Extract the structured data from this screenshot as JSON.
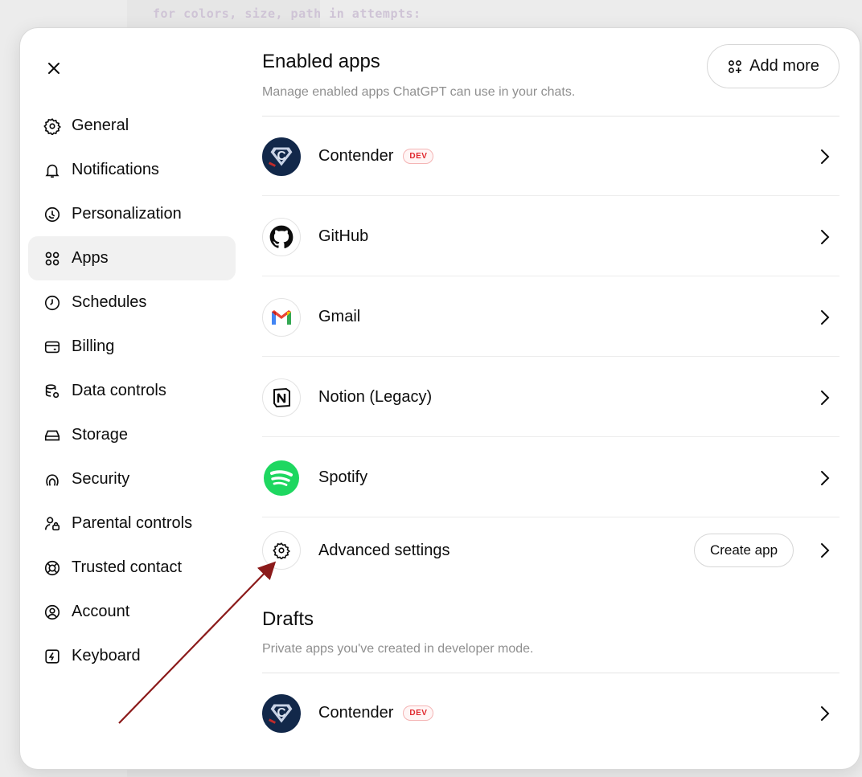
{
  "backdrop": {
    "code_line": "for colors, size, path in attempts:"
  },
  "sidebar": {
    "items": [
      {
        "label": "General",
        "icon": "gear-icon",
        "active": false
      },
      {
        "label": "Notifications",
        "icon": "bell-icon",
        "active": false
      },
      {
        "label": "Personalization",
        "icon": "personalization-icon",
        "active": false
      },
      {
        "label": "Apps",
        "icon": "apps-grid-icon",
        "active": true
      },
      {
        "label": "Schedules",
        "icon": "clock-icon",
        "active": false
      },
      {
        "label": "Billing",
        "icon": "card-icon",
        "active": false
      },
      {
        "label": "Data controls",
        "icon": "database-icon",
        "active": false
      },
      {
        "label": "Storage",
        "icon": "storage-icon",
        "active": false
      },
      {
        "label": "Security",
        "icon": "fingerprint-icon",
        "active": false
      },
      {
        "label": "Parental controls",
        "icon": "parental-icon",
        "active": false
      },
      {
        "label": "Trusted contact",
        "icon": "lifebuoy-icon",
        "active": false
      },
      {
        "label": "Account",
        "icon": "account-icon",
        "active": false
      },
      {
        "label": "Keyboard",
        "icon": "keyboard-icon",
        "active": false
      }
    ]
  },
  "enabled": {
    "title": "Enabled apps",
    "subtitle": "Manage enabled apps ChatGPT can use in your chats.",
    "add_more_label": "Add more",
    "apps": [
      {
        "name": "Contender",
        "badge": "DEV",
        "icon": "contender-logo-icon"
      },
      {
        "name": "GitHub",
        "badge": "",
        "icon": "github-logo-icon"
      },
      {
        "name": "Gmail",
        "badge": "",
        "icon": "gmail-logo-icon"
      },
      {
        "name": "Notion (Legacy)",
        "badge": "",
        "icon": "notion-logo-icon"
      },
      {
        "name": "Spotify",
        "badge": "",
        "icon": "spotify-logo-icon"
      }
    ],
    "advanced": {
      "name": "Advanced settings",
      "create_label": "Create app",
      "icon": "gear-icon"
    }
  },
  "drafts": {
    "title": "Drafts",
    "subtitle": "Private apps you've created in developer mode.",
    "apps": [
      {
        "name": "Contender",
        "badge": "DEV",
        "icon": "contender-logo-icon"
      }
    ]
  },
  "colors": {
    "accent_dev": "#e0282e",
    "annotation_arrow": "#8b1a1a",
    "spotify": "#1ed760",
    "contender_bg": "#12284a"
  }
}
